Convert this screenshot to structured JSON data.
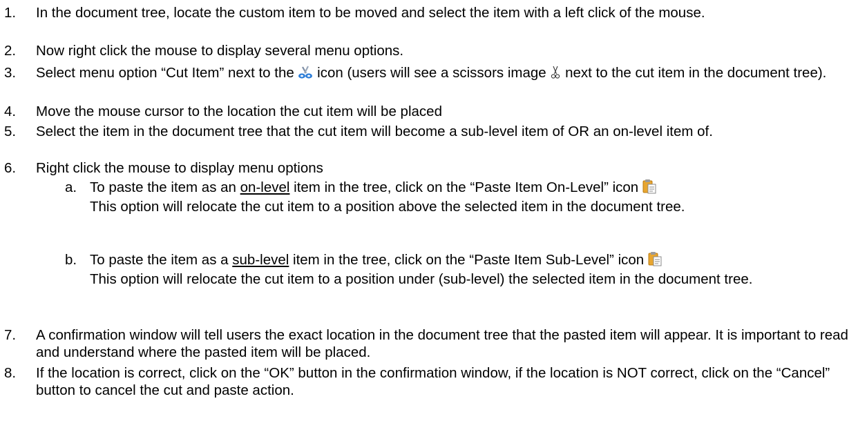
{
  "steps": [
    {
      "num": "1.",
      "text": "In the document tree, locate the custom item to be moved and select the item with a left click of the mouse."
    },
    {
      "num": "2.",
      "text": "Now right click the mouse to display several menu options."
    },
    {
      "num": "3.",
      "pre": "Select menu option “Cut Item” next to the ",
      "mid": " icon (users will see a scissors image ",
      "post": " next to the cut item in the document tree)."
    },
    {
      "num": "4.",
      "text": "Move the mouse cursor to the location the cut item will be placed"
    },
    {
      "num": "5.",
      "text": "Select the item in the document tree that the cut item will become a sub-level item of OR an on-level item of."
    },
    {
      "num": "6.",
      "text": "Right click the mouse to display menu options"
    },
    {
      "num": "7.",
      "text": "A confirmation window will tell users the exact location in the document tree that the pasted item will appear. It is important to read and understand where the pasted item will be placed."
    },
    {
      "num": "8.",
      "text": "If the location is correct, click on the “OK” button in the confirmation window, if the location is NOT correct, click on the “Cancel” button to cancel the cut and paste action."
    }
  ],
  "substeps": [
    {
      "letter": "a.",
      "pre": "To paste the item as an ",
      "underline": "on-level",
      "mid": " item in the tree, click on the “Paste Item On-Level” icon",
      "post": "This option will relocate the cut item to a position above the selected item in the document tree."
    },
    {
      "letter": "b.",
      "pre": "To paste the item as a ",
      "underline": "sub-level",
      "mid": " item in the tree, click on the “Paste Item Sub-Level” icon",
      "post": "This option will relocate the cut item to a position under (sub-level) the selected item in the document tree."
    }
  ],
  "icons": {
    "cut_menu": "scissors-blue-icon",
    "cut_marker": "scissors-outline-icon",
    "paste": "paste-clipboard-icon"
  }
}
